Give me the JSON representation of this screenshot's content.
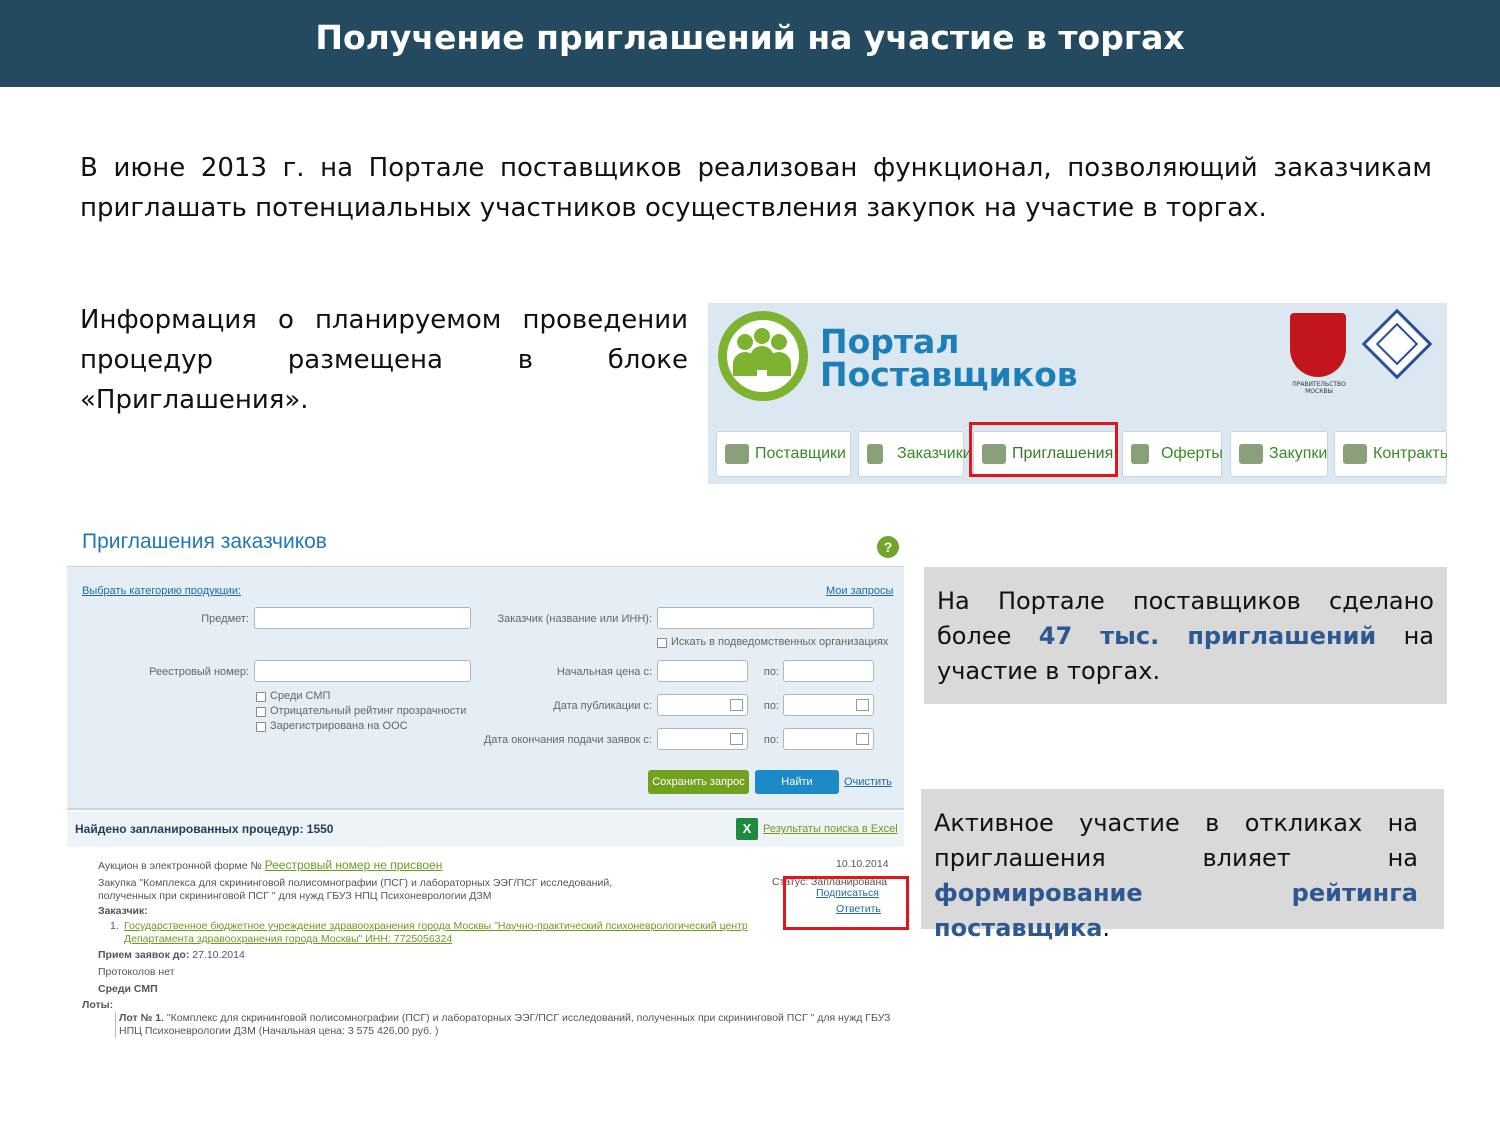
{
  "header": {
    "title": "Получение приглашений на участие в торгах"
  },
  "intro": "В июне 2013 г. на Портале поставщиков реализован функционал, позволяющий заказчикам приглашать потенциальных участников осуществления закупок на участие в торгах.",
  "info": "Информация о планируемом проведении процедур размещена в блоке «Приглашения».",
  "portal": {
    "title_line1": "Портал",
    "title_line2": "Поставщиков",
    "emblem_caption": "ПРАВИТЕЛЬСТВО МОСКВЫ",
    "tabs": [
      {
        "label": "Поставщики"
      },
      {
        "label": "Заказчики"
      },
      {
        "label": "Приглашения"
      },
      {
        "label": "Оферты"
      },
      {
        "label": "Закупки"
      },
      {
        "label": "Контракты"
      }
    ]
  },
  "invitations": {
    "title": "Приглашения заказчиков",
    "help": "?",
    "choose_category": "Выбрать категорию продукции:",
    "my_requests": "Мои запросы",
    "subject_label": "Предмет:",
    "customer_label": "Заказчик (название или ИНН):",
    "subordinate_check": "Искать в подведомственных организациях",
    "registry_label": "Реестровый номер:",
    "start_price_label": "Начальная цена с:",
    "pub_date_label": "Дата публикации с:",
    "end_date_label": "Дата окончания подачи заявок с:",
    "to_label": "по:",
    "checks": [
      "Среди СМП",
      "Отрицательный рейтинг прозрачности",
      "Зарегистрирована на ООС"
    ],
    "save_button": "Сохранить запрос",
    "find_button": "Найти",
    "clear_link": "Очистить",
    "found_text": "Найдено запланированных процедур: 1550",
    "excel_icon": "X",
    "excel_link": "Результаты поиска в Excel",
    "result": {
      "type": "Аукцион в электронной форме №",
      "registry": "Реестровый номер не присвоен",
      "date": "10.10.2014",
      "purchase_line1": "Закупка \"Комплекса для скрининговой полисомнографии (ПСГ) и лабораторных ЭЭГ/ПСГ исследований,",
      "purchase_line2": "полученных при скрининговой ПСГ \" для нужд ГБУЗ НПЦ Психоневрологии ДЗМ",
      "status": "Статус: Запланирована",
      "subscribe": "Подписаться",
      "reply": "Ответить",
      "customer_label": "Заказчик:",
      "customer_num": "1.",
      "customer_line1": "Государственное бюджетное учреждение здравоохранения города Москвы \"Научно-практический психоневрологический центр",
      "customer_line2": "Департамента здравоохранения города Москвы\" ИНН: 7725056324",
      "deadline_label": "Прием заявок до:",
      "deadline_value": "27.10.2014",
      "protocols": "Протоколов нет",
      "smp": "Среди СМП",
      "lots_label": "Лоты:",
      "lot_title": "Лот № 1.",
      "lot_line1": "\"Комплекс для скрининговой полисомнографии (ПСГ) и лабораторных ЭЭГ/ПСГ исследований, полученных при скрининговой ПСГ \" для нужд ГБУЗ",
      "lot_line2": "НПЦ Психоневрологии ДЗМ (Начальная цена: 3 575 426,00 руб. )"
    }
  },
  "callout1": {
    "before": "На Портале поставщиков сделано более ",
    "highlight": "47 тыс. приглашений",
    "after": " на участие в торгах."
  },
  "callout2": {
    "before": "Активное участие в откликах на приглашения влияет на ",
    "highlight": "формирование рейтинга поставщика",
    "after": "."
  },
  "colors": {
    "header": "#234a5e",
    "highlight_text": "#2e5891",
    "red_frame": "#e0161c"
  }
}
